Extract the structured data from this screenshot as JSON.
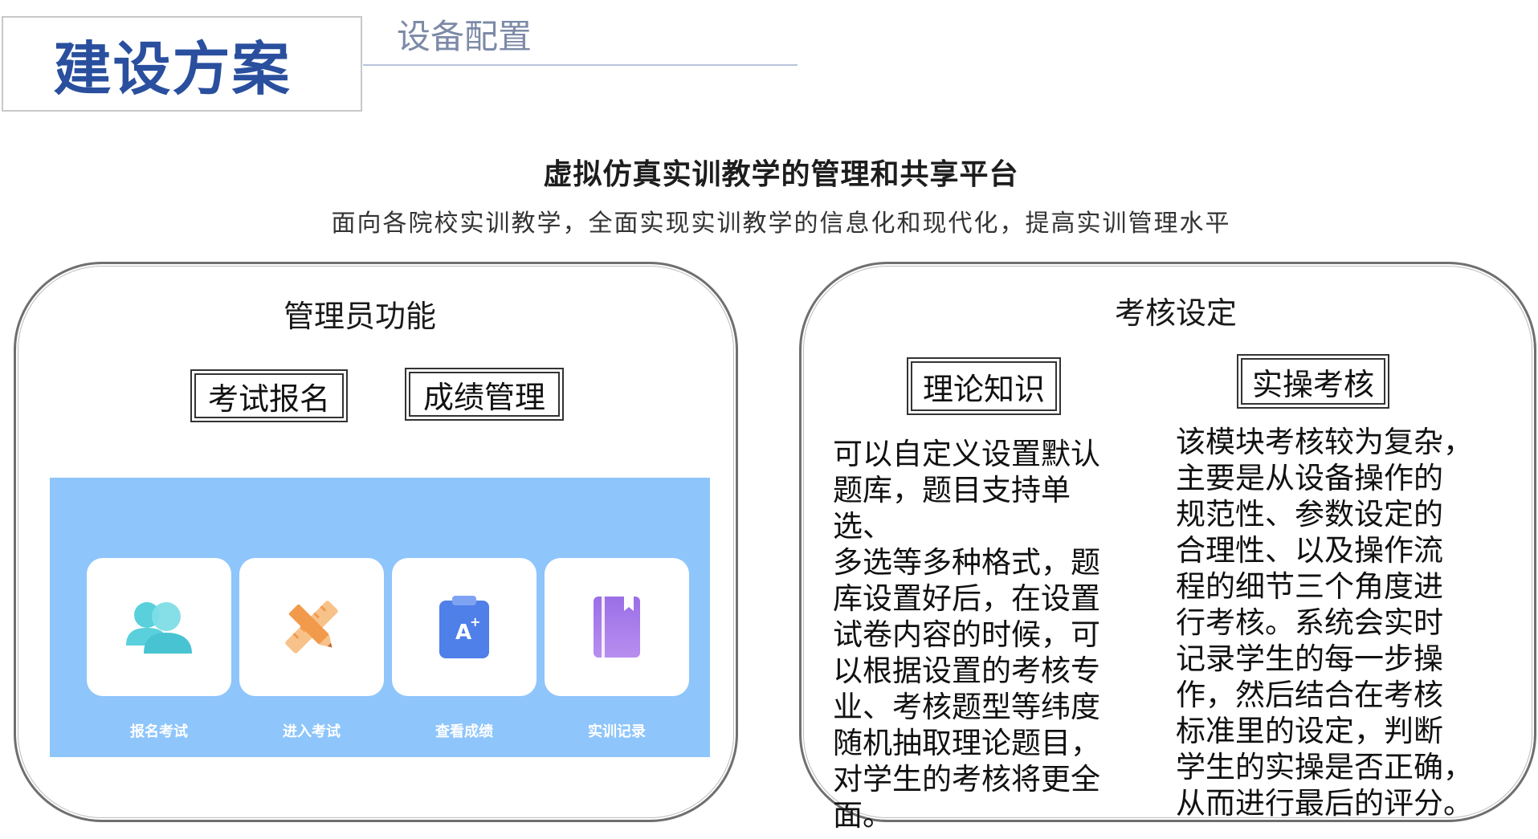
{
  "header": {
    "title": "建设方案",
    "section": "设备配置"
  },
  "intro": {
    "heading": "虚拟仿真实训教学的管理和共享平台",
    "subheading": "面向各院校实训教学，全面实现实训教学的信息化和现代化，提高实训管理水平"
  },
  "admin_panel": {
    "title": "管理员功能",
    "buttons": [
      "考试报名",
      "成绩管理"
    ],
    "apps": [
      {
        "label": "报名考试",
        "icon": "users-icon"
      },
      {
        "label": "进入考试",
        "icon": "pencil-ruler-icon"
      },
      {
        "label": "查看成绩",
        "icon": "grade-clipboard-icon"
      },
      {
        "label": "实训记录",
        "icon": "notebook-icon"
      }
    ],
    "colors": {
      "app_background": "#8ec5fb",
      "users_icon": "#5ad0dc",
      "pencil_icon": "#f29a4b",
      "clipboard_icon": "#4f7fe8",
      "notebook_icon": "#a67ce8"
    }
  },
  "assessment_panel": {
    "title": "考核设定",
    "theory": {
      "label": "理论知识",
      "text": "可以自定义设置默认\n题库，题目支持单选、\n多选等多种格式，题\n库设置好后，在设置\n试卷内容的时候，可\n以根据设置的考核专\n业、考核题型等纬度\n随机抽取理论题目，\n对学生的考核将更全\n面。"
    },
    "practice": {
      "label": "实操考核",
      "text": "该模块考核较为复杂，\n主要是从设备操作的\n规范性、参数设定的\n合理性、以及操作流\n程的细节三个角度进\n行考核。系统会实时\n记录学生的每一步操\n作，然后结合在考核\n标准里的设定，判断\n学生的实操是否正确，\n从而进行最后的评分。"
    }
  },
  "colors": {
    "title": "#2a4f9e",
    "section_tag": "#7d8aa7"
  }
}
